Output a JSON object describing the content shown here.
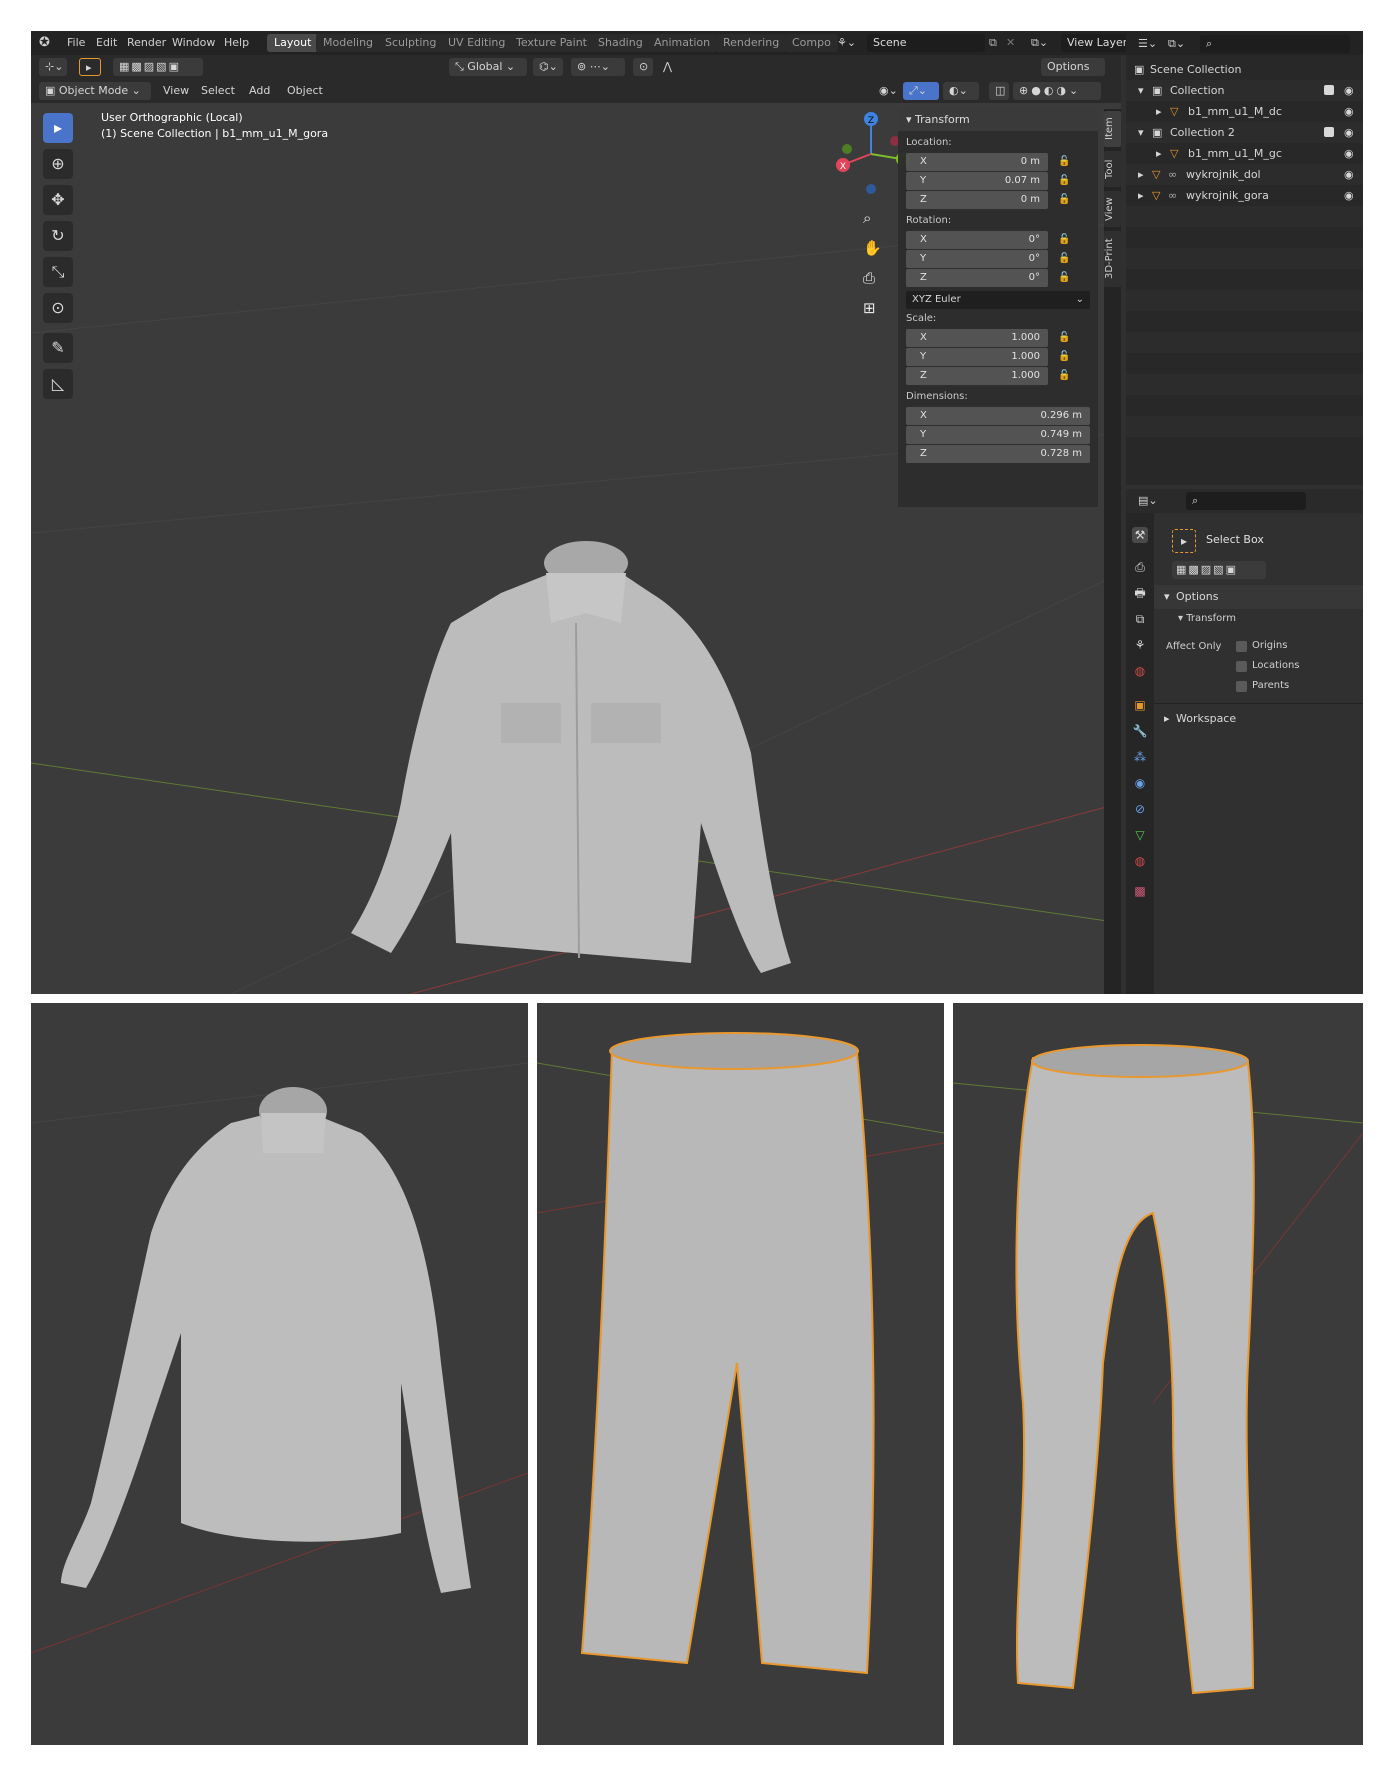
{
  "topbar": {
    "menus": [
      "File",
      "Edit",
      "Render",
      "Window",
      "Help"
    ],
    "workspaces": [
      "Layout",
      "Modeling",
      "Sculpting",
      "UV Editing",
      "Texture Paint",
      "Shading",
      "Animation",
      "Rendering",
      "Compo"
    ],
    "active_workspace": "Layout",
    "scene": "Scene",
    "view_layer": "View Layer"
  },
  "tool_header": {
    "orientation": "Global",
    "options_label": "Options"
  },
  "view_header": {
    "mode": "Object Mode",
    "menus": [
      "View",
      "Select",
      "Add",
      "Object"
    ]
  },
  "viewport": {
    "view_name": "User Orthographic (Local)",
    "collection_info": "(1) Scene Collection | b1_mm_u1_M_gora",
    "gizmo_axes": {
      "z": "Z",
      "y": "Y",
      "x": "X"
    }
  },
  "npanel": {
    "header": "Transform",
    "location_label": "Location:",
    "location": [
      {
        "axis": "X",
        "value": "0 m"
      },
      {
        "axis": "Y",
        "value": "0.07 m"
      },
      {
        "axis": "Z",
        "value": "0 m"
      }
    ],
    "rotation_label": "Rotation:",
    "rotation": [
      {
        "axis": "X",
        "value": "0°"
      },
      {
        "axis": "Y",
        "value": "0°"
      },
      {
        "axis": "Z",
        "value": "0°"
      }
    ],
    "rotation_mode": "XYZ Euler",
    "scale_label": "Scale:",
    "scale": [
      {
        "axis": "X",
        "value": "1.000"
      },
      {
        "axis": "Y",
        "value": "1.000"
      },
      {
        "axis": "Z",
        "value": "1.000"
      }
    ],
    "dimensions_label": "Dimensions:",
    "dimensions": [
      {
        "axis": "X",
        "value": "0.296 m"
      },
      {
        "axis": "Y",
        "value": "0.749 m"
      },
      {
        "axis": "Z",
        "value": "0.728 m"
      }
    ],
    "tabs": [
      "Item",
      "Tool",
      "View",
      "3D-Print"
    ]
  },
  "outliner": {
    "root": "Scene Collection",
    "items": [
      {
        "label": "Collection",
        "type": "collection"
      },
      {
        "label": "b1_mm_u1_M_dc",
        "type": "mesh"
      },
      {
        "label": "Collection 2",
        "type": "collection"
      },
      {
        "label": "b1_mm_u1_M_gc",
        "type": "mesh"
      },
      {
        "label": "wykrojnik_dol",
        "type": "mesh"
      },
      {
        "label": "wykrojnik_gora",
        "type": "mesh"
      }
    ]
  },
  "properties": {
    "tool_name": "Select Box",
    "options_label": "Options",
    "transform_label": "Transform",
    "affect_only_label": "Affect Only",
    "affect_only": [
      "Origins",
      "Locations",
      "Parents"
    ],
    "workspace_label": "Workspace"
  },
  "colors": {
    "accent": "#4a74c9",
    "selection_outline": "#e8982e",
    "mesh": "#bdbdbd"
  }
}
